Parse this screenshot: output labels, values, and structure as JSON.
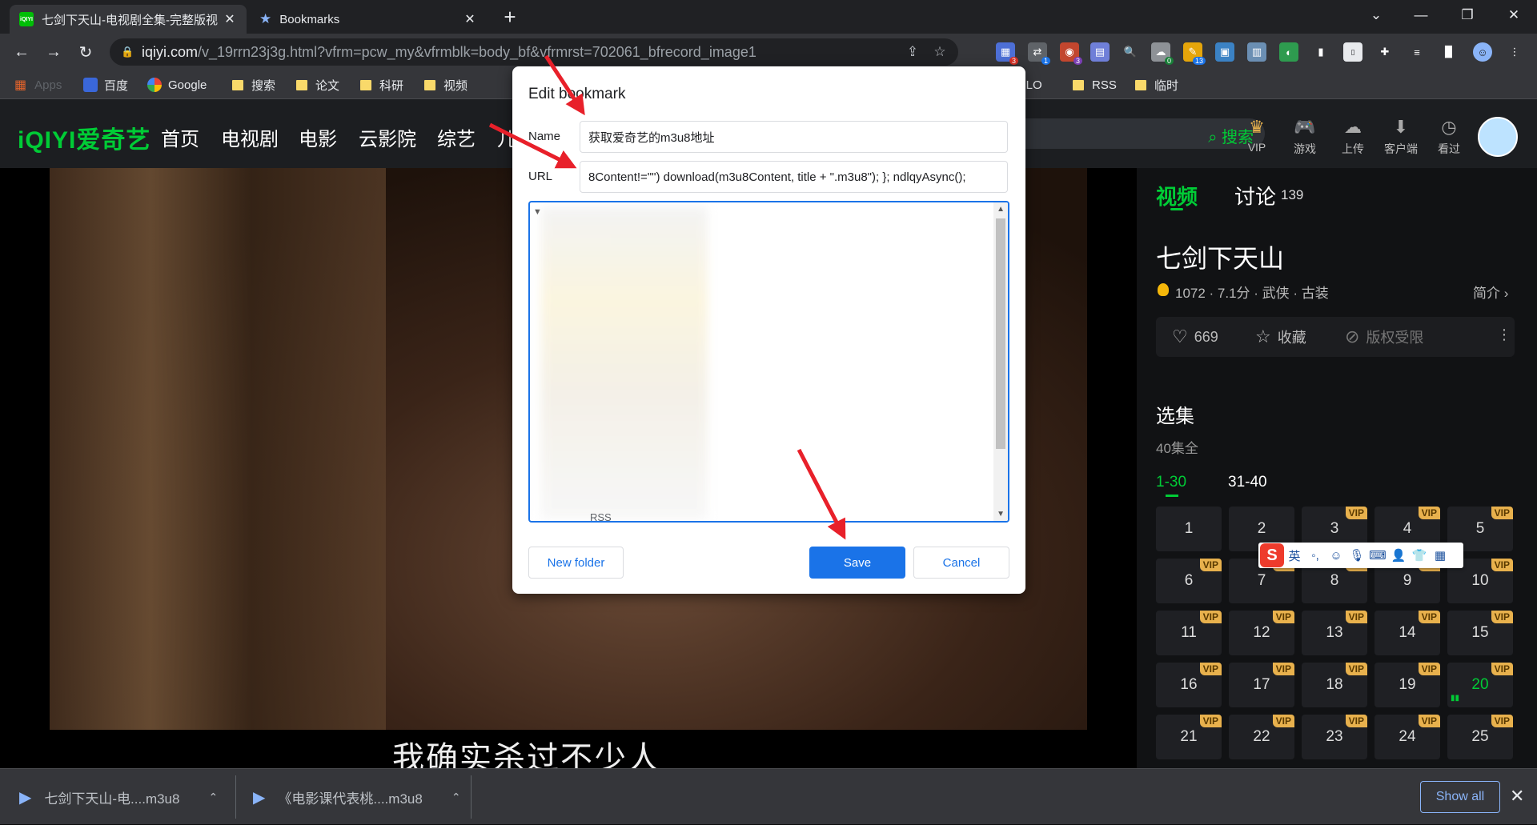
{
  "browser": {
    "tabs": [
      {
        "title": "七剑下天山-电视剧全集-完整版视",
        "favicon": "iqiyi-icon",
        "active": true
      },
      {
        "title": "Bookmarks",
        "favicon": "star-icon",
        "active": false
      }
    ],
    "url_host": "iqiyi.com",
    "url_rest": "/v_19rrn23j3g.html?vfrm=pcw_my&vfrmblk=body_bf&vfrmrst=702061_bfrecord_image1",
    "extension_badges": [
      "3",
      "1",
      "3",
      "0",
      "13"
    ],
    "bookmarks_bar": [
      {
        "label": "Apps",
        "icon": "apps-grid-icon"
      },
      {
        "label": "百度",
        "icon": "baidu-icon"
      },
      {
        "label": "Google",
        "icon": "google-icon"
      },
      {
        "label": "搜索",
        "icon": "folder-icon"
      },
      {
        "label": "论文",
        "icon": "folder-icon"
      },
      {
        "label": "科研",
        "icon": "folder-icon"
      },
      {
        "label": "视频",
        "icon": "folder-icon"
      },
      {
        "label": "YOLO",
        "icon": "folder-icon"
      },
      {
        "label": "RSS",
        "icon": "folder-icon"
      },
      {
        "label": "临时",
        "icon": "folder-icon"
      }
    ]
  },
  "iqiyi": {
    "logo": "iQIYI爱奇艺",
    "nav": [
      "首页",
      "电视剧",
      "电影",
      "云影院",
      "综艺",
      "儿"
    ],
    "search_button": "搜索",
    "tools": [
      "VIP",
      "游戏",
      "上传",
      "客户端",
      "看过"
    ],
    "subtitle": "我确实杀过不少人",
    "panel": {
      "tab_video": "视频",
      "tab_discuss": "讨论",
      "discuss_count": "139",
      "show_title": "七剑下天山",
      "meta": "1072 · 7.1分 · 武侠 · 古装",
      "intro": "简介",
      "likes": "669",
      "favorite": "收藏",
      "copyright": "版权受限",
      "episodes_title": "选集",
      "episodes_total": "40集全",
      "range_active": "1-30",
      "range_other": "31-40",
      "vip_label": "VIP",
      "playing_episode": "20",
      "episodes": [
        {
          "n": "1",
          "vip": false
        },
        {
          "n": "2",
          "vip": false
        },
        {
          "n": "3",
          "vip": true
        },
        {
          "n": "4",
          "vip": true
        },
        {
          "n": "5",
          "vip": true
        },
        {
          "n": "6",
          "vip": true
        },
        {
          "n": "7",
          "vip": true
        },
        {
          "n": "8",
          "vip": true
        },
        {
          "n": "9",
          "vip": true
        },
        {
          "n": "10",
          "vip": true
        },
        {
          "n": "11",
          "vip": true
        },
        {
          "n": "12",
          "vip": true
        },
        {
          "n": "13",
          "vip": true
        },
        {
          "n": "14",
          "vip": true
        },
        {
          "n": "15",
          "vip": true
        },
        {
          "n": "16",
          "vip": true
        },
        {
          "n": "17",
          "vip": true
        },
        {
          "n": "18",
          "vip": true
        },
        {
          "n": "19",
          "vip": true
        },
        {
          "n": "20",
          "vip": true
        },
        {
          "n": "21",
          "vip": true
        },
        {
          "n": "22",
          "vip": true
        },
        {
          "n": "23",
          "vip": true
        },
        {
          "n": "24",
          "vip": true
        },
        {
          "n": "25",
          "vip": true
        }
      ]
    },
    "ime": {
      "lang": "英"
    }
  },
  "dialog": {
    "title": "Edit bookmark",
    "name_label": "Name",
    "name_value": "获取爱奇艺的m3u8地址",
    "url_label": "URL",
    "url_value": "8Content!=\"\") download(m3u8Content, title + \".m3u8\"); }; ndlqyAsync();",
    "tree_visible_item": "RSS",
    "new_folder": "New folder",
    "save": "Save",
    "cancel": "Cancel"
  },
  "downloads": {
    "items": [
      "七剑下天山-电....m3u8",
      "《电影课代表桃....m3u8"
    ],
    "show_all": "Show all"
  },
  "colors": {
    "accent": "#1a73e8",
    "iqiyi_green": "#00cc36",
    "vip_gold": "#e8b14d",
    "arrow_red": "#e8202a"
  }
}
